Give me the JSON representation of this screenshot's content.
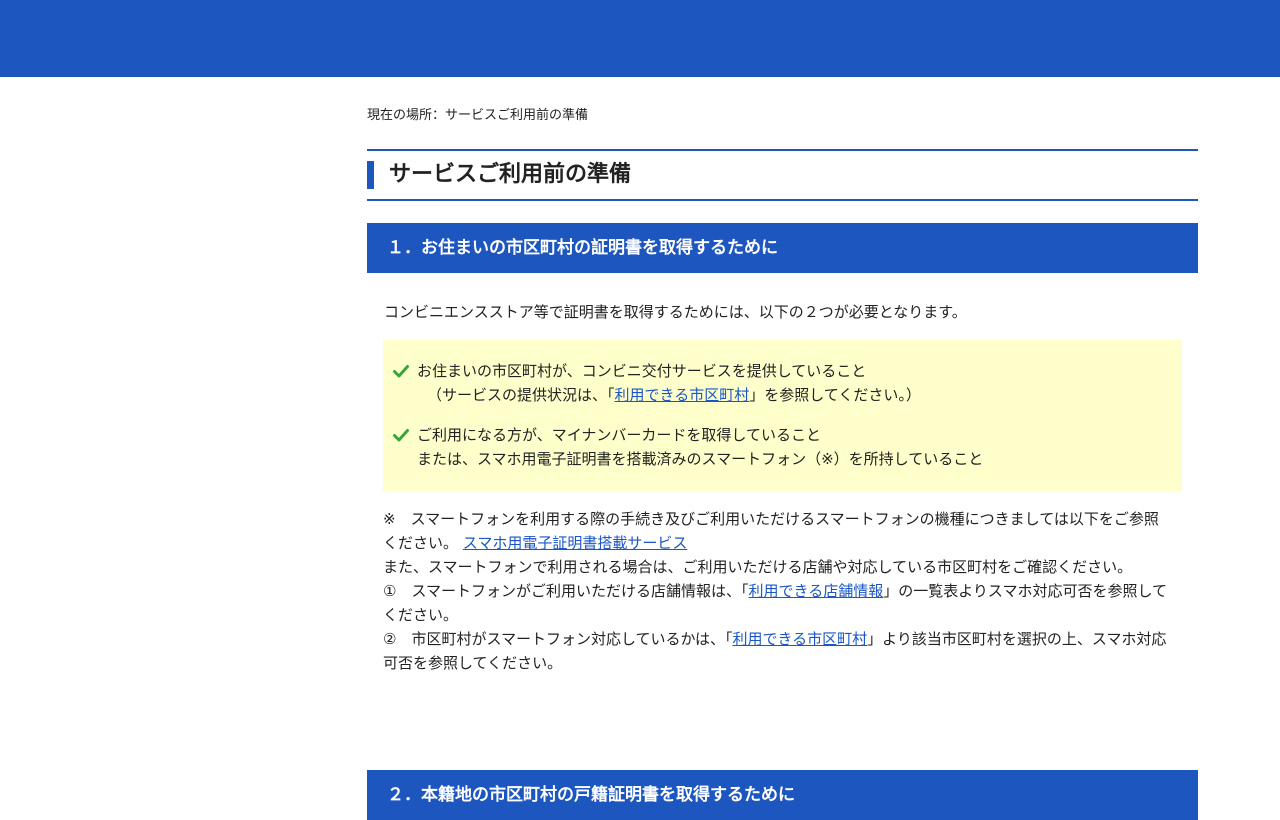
{
  "breadcrumb": {
    "prefix": "現在の場所：",
    "current": "サービスご利用前の準備"
  },
  "page_title": "サービスご利用前の準備",
  "section1": {
    "title": "１．お住まいの市区町村の証明書を取得するために",
    "intro": "コンビニエンスストア等で証明書を取得するためには、以下の２つが必要となります。",
    "requirements": [
      {
        "line1": "お住まいの市区町村が、コンビニ交付サービスを提供していること",
        "line2_before": "（サービスの提供状況は、「",
        "line2_link": "利用できる市区町村",
        "line2_after": "」を参照してください。）"
      },
      {
        "line1": "ご利用になる方が、マイナンバーカードを取得していること",
        "line2": "または、スマホ用電子証明書を搭載済みのスマートフォン（※）を所持していること"
      }
    ],
    "notes": {
      "note1_text": "※　スマートフォンを利用する際の手続き及びご利用いただけるスマートフォンの機種につきましては以下をご参照ください。",
      "note1_link": "スマホ用電子証明書搭載サービス",
      "note2_text": "また、スマートフォンで利用される場合は、ご利用いただける店舗や対応している市区町村をご確認ください。",
      "note3_before": "①　スマートフォンがご利用いただける店舗情報は、「",
      "note3_link": "利用できる店舗情報",
      "note3_after": "」の一覧表よりスマホ対応可否を参照してください。",
      "note4_before": "②　市区町村がスマートフォン対応しているかは、「",
      "note4_link": "利用できる市区町村",
      "note4_after": "」より該当市区町村を選択の上、スマホ対応可否を参照してください。"
    }
  },
  "section2": {
    "title": "２．本籍地の市区町村の戸籍証明書を取得するために"
  },
  "colors": {
    "brand_blue": "#1d56bf",
    "highlight_yellow": "#ffffcc",
    "check_green": "#3aa53a",
    "link_blue": "#1a56c6"
  },
  "icons": {
    "requirement_marker": "check-icon"
  }
}
